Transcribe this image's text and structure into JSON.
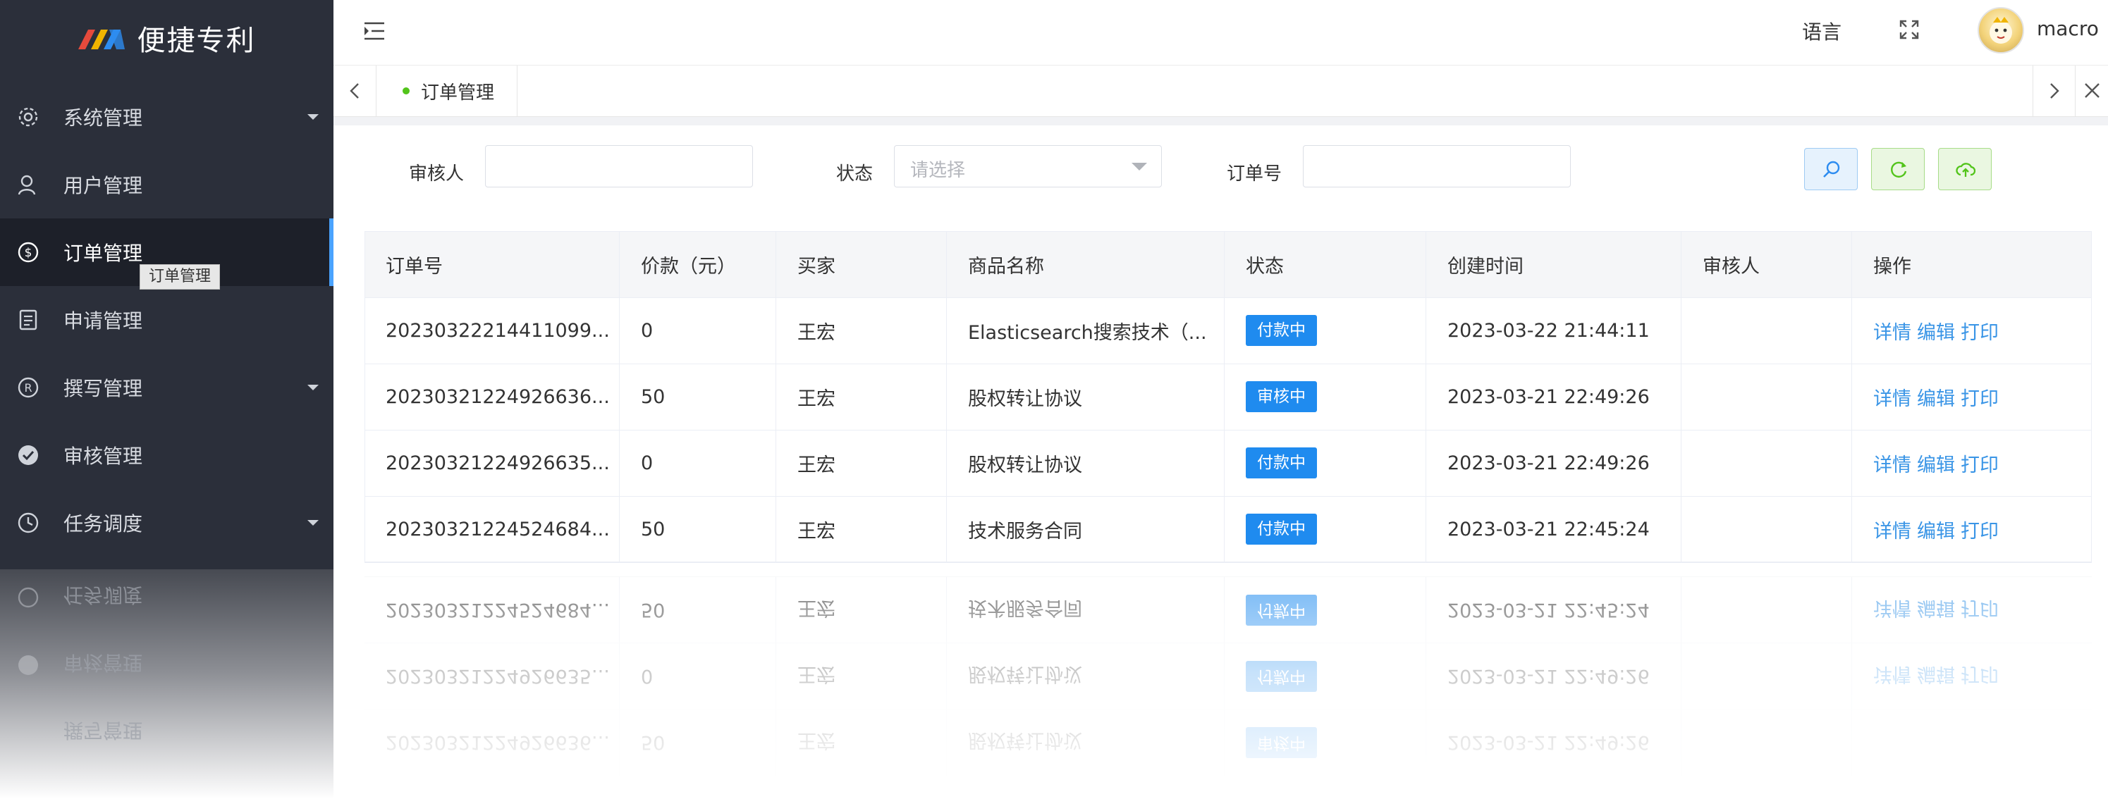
{
  "brand": {
    "name": "便捷专利",
    "colors": [
      "#e64a3c",
      "#f0b400",
      "#2d8cf0"
    ]
  },
  "sidebar": {
    "items": [
      {
        "label": "系统管理",
        "icon": "gear-icon",
        "expandable": true
      },
      {
        "label": "用户管理",
        "icon": "user-icon",
        "expandable": false
      },
      {
        "label": "订单管理",
        "icon": "dollar-circle-icon",
        "expandable": false,
        "active": true
      },
      {
        "label": "申请管理",
        "icon": "form-icon",
        "expandable": false
      },
      {
        "label": "撰写管理",
        "icon": "registered-icon",
        "expandable": true
      },
      {
        "label": "审核管理",
        "icon": "check-circle-icon",
        "expandable": false
      },
      {
        "label": "任务调度",
        "icon": "clock-icon",
        "expandable": true
      }
    ],
    "tooltip": "订单管理"
  },
  "header": {
    "language": "语言",
    "username": "macro"
  },
  "tabs": [
    {
      "label": "订单管理"
    }
  ],
  "filters": {
    "reviewer_label": "审核人",
    "status_label": "状态",
    "status_placeholder": "请选择",
    "order_no_label": "订单号"
  },
  "table": {
    "columns": [
      "订单号",
      "价款（元）",
      "买家",
      "商品名称",
      "状态",
      "创建时间",
      "审核人",
      "操作"
    ],
    "rows": [
      {
        "order_no": "20230322214411099...",
        "price": "0",
        "buyer": "王宏",
        "product": "Elasticsearch搜索技术（...",
        "status": "付款中",
        "created": "2023-03-22 21:44:11",
        "reviewer": ""
      },
      {
        "order_no": "20230321224926636...",
        "price": "50",
        "buyer": "王宏",
        "product": "股权转让协议",
        "status": "审核中",
        "created": "2023-03-21 22:49:26",
        "reviewer": ""
      },
      {
        "order_no": "20230321224926635...",
        "price": "0",
        "buyer": "王宏",
        "product": "股权转让协议",
        "status": "付款中",
        "created": "2023-03-21 22:49:26",
        "reviewer": ""
      },
      {
        "order_no": "20230321224524684...",
        "price": "50",
        "buyer": "王宏",
        "product": "技术服务合同",
        "status": "付款中",
        "created": "2023-03-21 22:45:24",
        "reviewer": ""
      }
    ],
    "actions": [
      "详情",
      "编辑",
      "打印"
    ]
  }
}
